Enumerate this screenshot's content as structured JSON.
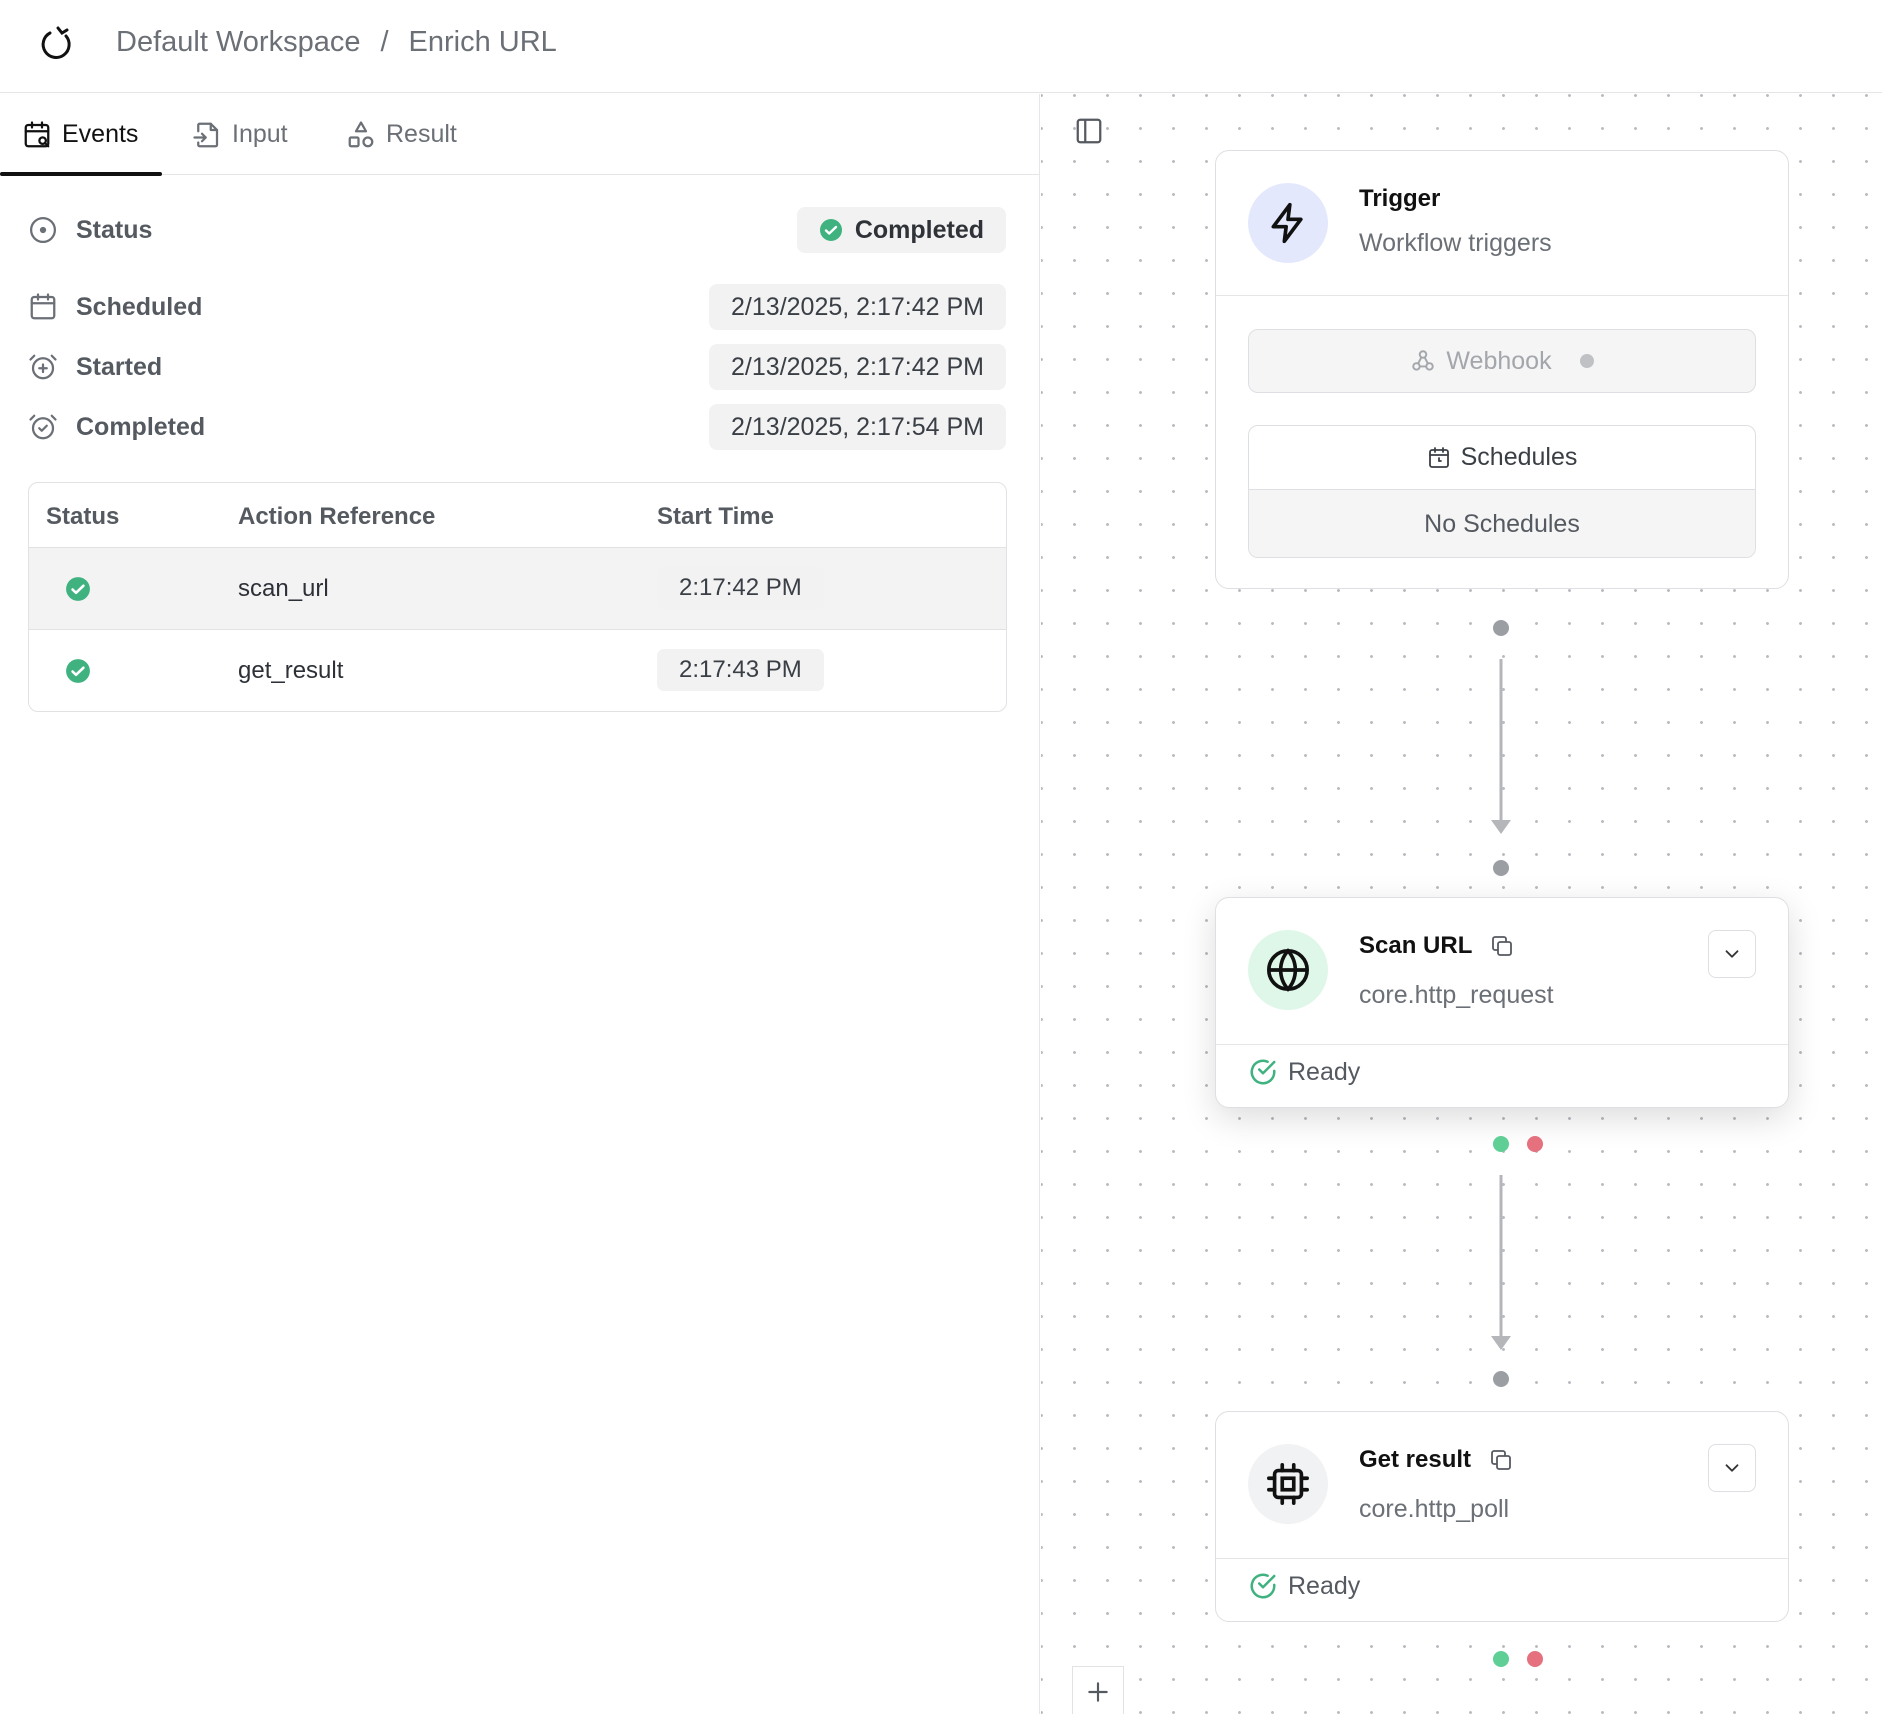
{
  "header": {
    "workspace": "Default Workspace",
    "separator": "/",
    "workflow": "Enrich URL"
  },
  "tabs": [
    {
      "label": "Events",
      "icon": "calendar-search-icon",
      "active": true
    },
    {
      "label": "Input",
      "icon": "file-input-icon",
      "active": false
    },
    {
      "label": "Result",
      "icon": "shapes-icon",
      "active": false
    }
  ],
  "run": {
    "status_label": "Status",
    "status_value": "Completed",
    "scheduled_label": "Scheduled",
    "scheduled_value": "2/13/2025, 2:17:42 PM",
    "started_label": "Started",
    "started_value": "2/13/2025, 2:17:42 PM",
    "completed_label": "Completed",
    "completed_value": "2/13/2025, 2:17:54 PM"
  },
  "events_table": {
    "columns": [
      "Status",
      "Action Reference",
      "Start Time"
    ],
    "rows": [
      {
        "status": "success",
        "action_ref": "scan_url",
        "start_time": "2:17:42 PM",
        "selected": true
      },
      {
        "status": "success",
        "action_ref": "get_result",
        "start_time": "2:17:43 PM",
        "selected": false
      }
    ]
  },
  "canvas": {
    "trigger_node": {
      "title": "Trigger",
      "subtitle": "Workflow triggers",
      "webhook_label": "Webhook",
      "schedules_label": "Schedules",
      "no_schedules_label": "No Schedules"
    },
    "nodes": [
      {
        "title": "Scan URL",
        "type": "core.http_request",
        "status": "Ready",
        "icon": "globe-icon"
      },
      {
        "title": "Get result",
        "type": "core.http_poll",
        "status": "Ready",
        "icon": "cpu-icon"
      }
    ]
  },
  "colors": {
    "success": "#3fb27f",
    "error_handle": "#e5707e",
    "success_handle": "#5fcf96",
    "trigger_icon_bg": "#e4e8fd",
    "globe_icon_bg": "#dff7e8",
    "cpu_icon_bg": "#f1f2f4"
  }
}
